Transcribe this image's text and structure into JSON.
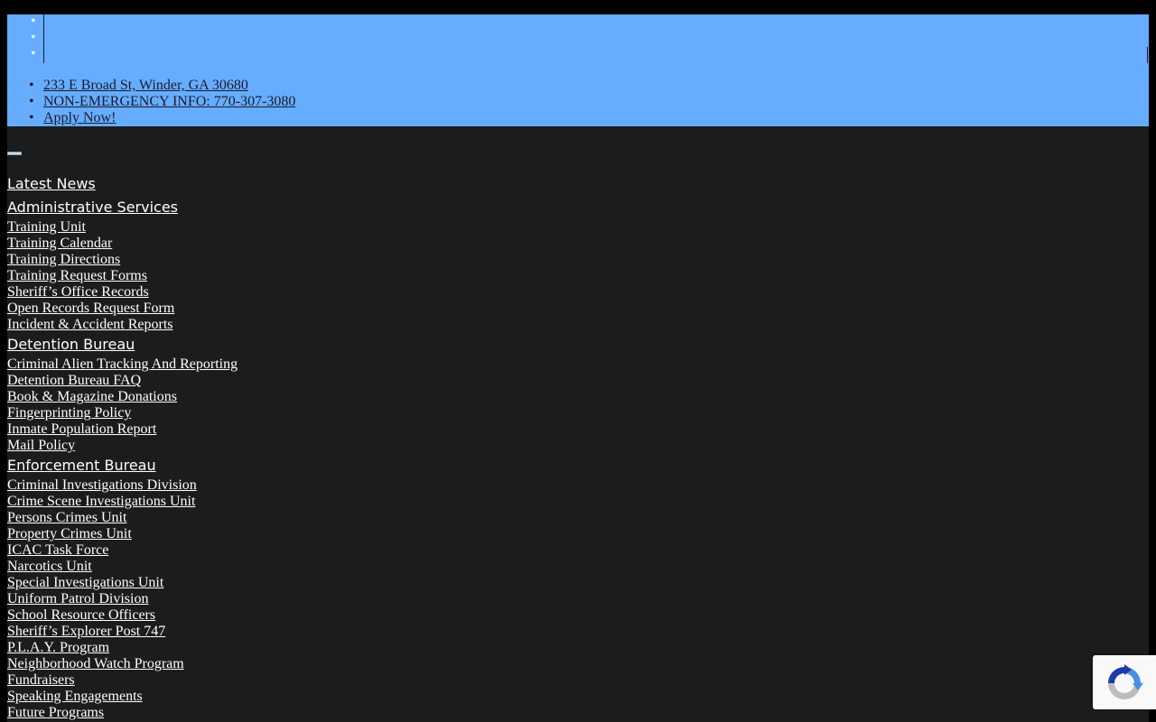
{
  "topbar": {
    "social_items": [
      "",
      "",
      ""
    ],
    "contact": {
      "address": "233 E Broad St, Winder, GA 30680",
      "phone": "NON-EMERGENCY INFO: 770-307-3080",
      "apply": "Apply Now!"
    }
  },
  "menu_toggle_icon": "menu-icon",
  "nav": {
    "latest_news": "Latest News",
    "administrative": {
      "label": "Administrative Services",
      "training_unit": {
        "label": "Training Unit",
        "items": [
          "Training Calendar",
          "Training Directions",
          "Training Request Forms"
        ]
      },
      "records": {
        "label": "Sheriff’s Office Records",
        "items": [
          "Open Records Request Form",
          "Incident & Accident Reports"
        ]
      }
    },
    "detention": {
      "label": "Detention Bureau",
      "items": [
        "Criminal Alien Tracking And Reporting",
        "Detention Bureau FAQ",
        "Book & Magazine Donations",
        "Fingerprinting Policy",
        "Inmate Population Report",
        "Mail Policy"
      ]
    },
    "enforcement": {
      "label": "Enforcement Bureau",
      "cid": {
        "label": "Criminal Investigations Division",
        "items": [
          "Crime Scene Investigations Unit",
          "Persons Crimes Unit",
          "Property Crimes Unit",
          "ICAC Task Force",
          "Narcotics Unit",
          "Special Investigations Unit"
        ]
      },
      "patrol": {
        "label": "Uniform Patrol Division",
        "sro": {
          "label": "School Resource Officers",
          "items": [
            "Sheriff’s Explorer Post 747",
            "P.L.A.Y. Program",
            "Neighborhood Watch Program",
            "Fundraisers",
            "Speaking Engagements",
            "Future Programs"
          ]
        }
      }
    }
  },
  "recaptcha_icon": "recaptcha-logo-icon"
}
